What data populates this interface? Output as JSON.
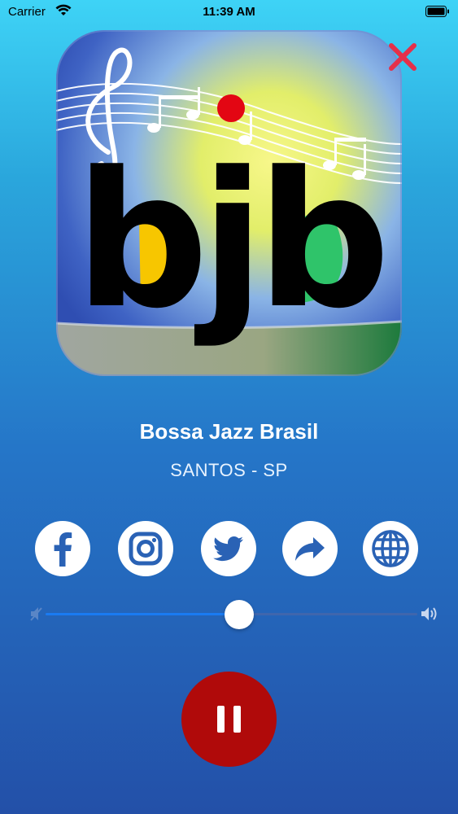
{
  "status_bar": {
    "carrier": "Carrier",
    "time": "11:39 AM"
  },
  "station": {
    "name": "Bossa Jazz Brasil",
    "location": "SANTOS - SP"
  },
  "logo": {
    "text": "bjb"
  },
  "social": [
    {
      "name": "facebook",
      "icon": "facebook-icon"
    },
    {
      "name": "instagram",
      "icon": "instagram-icon"
    },
    {
      "name": "twitter",
      "icon": "twitter-icon"
    },
    {
      "name": "share",
      "icon": "share-icon"
    },
    {
      "name": "website",
      "icon": "globe-icon"
    }
  ],
  "volume": {
    "level": 0.52
  },
  "player": {
    "state": "playing",
    "control_icon": "pause-icon"
  },
  "colors": {
    "close": "#e5304a",
    "pause_button": "#b00a0a",
    "volume_fill": "#1a7bf2",
    "icon_fill": "#2a62b5",
    "logo_dot": "#e30613",
    "logo_yellow": "#f7c600",
    "logo_green": "#2fc46a"
  }
}
